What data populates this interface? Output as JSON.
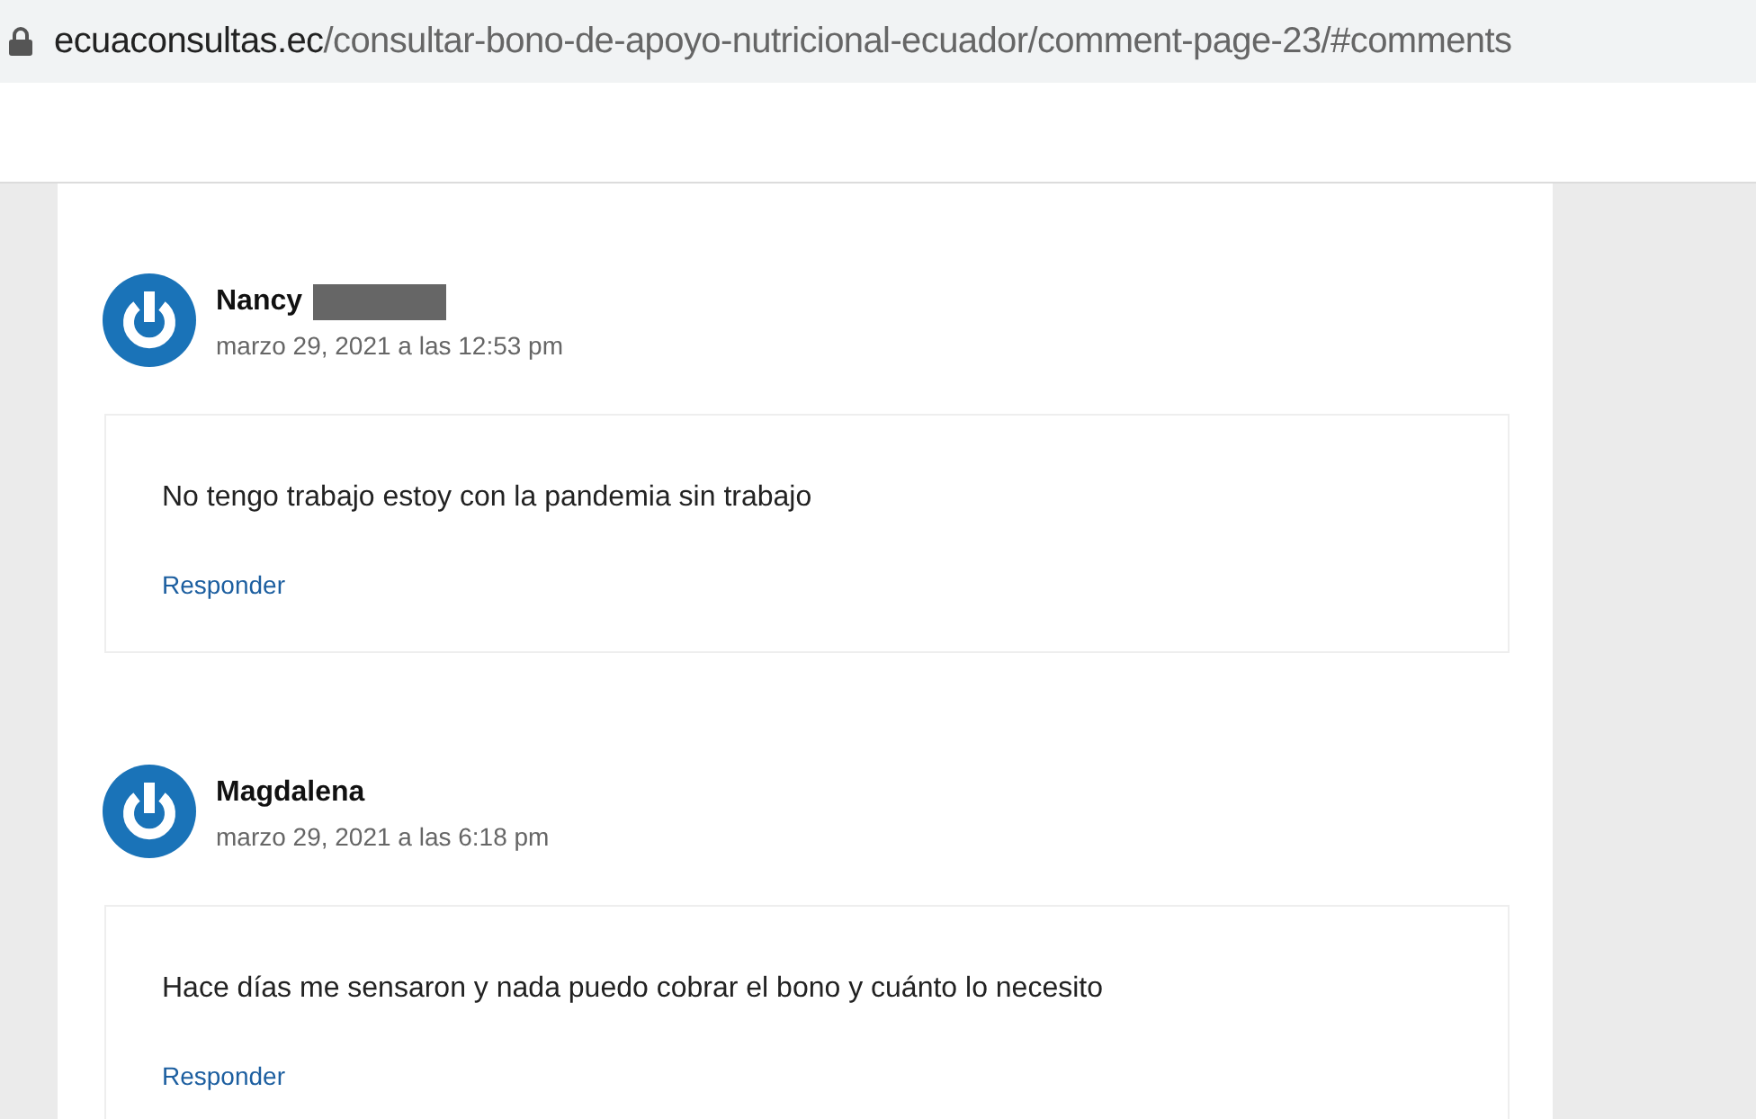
{
  "address_bar": {
    "domain": "ecuaconsultas.ec",
    "path": "/consultar-bono-de-apoyo-nutricional-ecuador/comment-page-23/#comments"
  },
  "comments": [
    {
      "author": "Nancy",
      "redacted": true,
      "date": "marzo 29, 2021 a las 12:53 pm",
      "text": "No tengo trabajo estoy con la pandemia sin trabajo",
      "reply": "Responder"
    },
    {
      "author": "Magdalena",
      "redacted": false,
      "date": "marzo 29, 2021 a las 6:18 pm",
      "text": "Hace días me sensaron y nada puedo cobrar el bono y cuánto lo necesito",
      "reply": "Responder"
    }
  ]
}
